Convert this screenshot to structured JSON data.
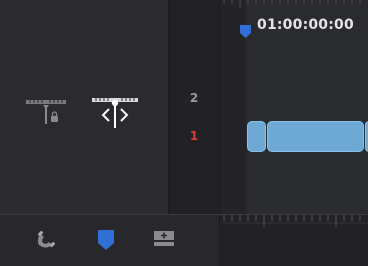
{
  "timeline": {
    "timecode": "01:00:00:00"
  },
  "tracks": [
    {
      "number": "2",
      "color": "#9a9a9e",
      "selected": false
    },
    {
      "number": "1",
      "color": "#e03a3a",
      "selected": true
    }
  ],
  "icons": {
    "lock_tool": "ruler-lock-icon",
    "trim_tool": "ruler-trim-icon",
    "snap": "magnet-snap-icon",
    "flag": "blue-flag-icon",
    "add_track": "add-track-icon"
  },
  "colors": {
    "accent": "#2f6fd6",
    "clip": "#6ea9d6",
    "track_active": "#e03a3a"
  }
}
